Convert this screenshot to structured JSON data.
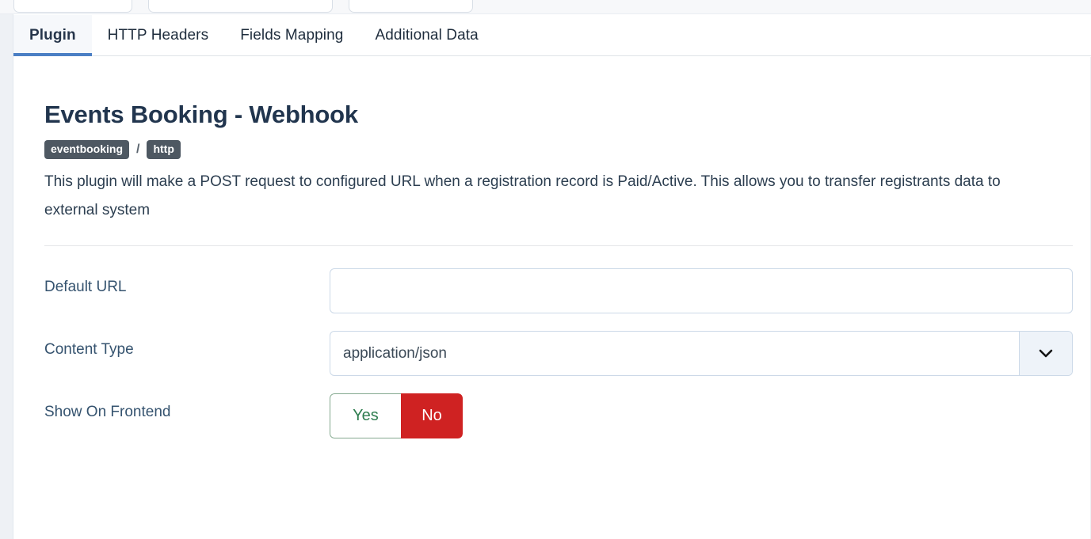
{
  "top_cards": [
    {
      "name": "top-card-1"
    },
    {
      "name": "top-card-2"
    },
    {
      "name": "top-card-3"
    }
  ],
  "tabs": [
    {
      "label": "Plugin",
      "active": true
    },
    {
      "label": "HTTP Headers",
      "active": false
    },
    {
      "label": "Fields Mapping",
      "active": false
    },
    {
      "label": "Additional Data",
      "active": false
    }
  ],
  "plugin": {
    "title": "Events Booking - Webhook",
    "badges": [
      "eventbooking",
      "http"
    ],
    "badge_separator": "/",
    "description": "This plugin will make a POST request to configured URL when a registration record is Paid/Active. This allows you to transfer registrants data to external system"
  },
  "form": {
    "default_url": {
      "label": "Default URL",
      "value": "",
      "placeholder": ""
    },
    "content_type": {
      "label": "Content Type",
      "value": "application/json",
      "icon": "chevron-down-icon"
    },
    "show_on_frontend": {
      "label": "Show On Frontend",
      "yes_label": "Yes",
      "no_label": "No",
      "selected": "No"
    }
  },
  "colors": {
    "accent_blue": "#4b7fc4",
    "title_navy": "#21354e",
    "badge_gray": "#4e5862",
    "danger_red": "#cf2222",
    "success_green": "#2e7d4f",
    "input_border": "#ccd9e8"
  }
}
